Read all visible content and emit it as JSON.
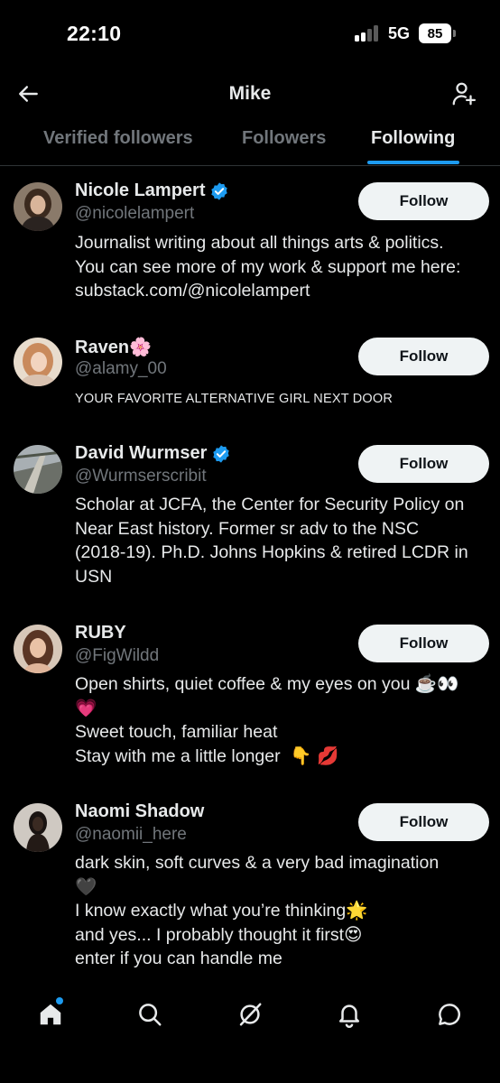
{
  "status_bar": {
    "time": "22:10",
    "network": "5G",
    "battery": "85"
  },
  "header": {
    "title": "Mike",
    "back_icon": "arrow-left-icon",
    "add_icon": "add-user-icon"
  },
  "tabs": [
    {
      "label": "Verified followers",
      "active": false
    },
    {
      "label": "Followers",
      "active": false
    },
    {
      "label": "Following",
      "active": true
    }
  ],
  "accent_color": "#1d9bf0",
  "users": [
    {
      "name": "Nicole Lampert",
      "verified": true,
      "handle": "@nicolelampert",
      "bio": "Journalist writing about all things arts & politics.\nYou can see more of my work & support me here:\nsubstack.com/@nicolelampert",
      "button": "Follow"
    },
    {
      "name": "Raven🌸",
      "verified": false,
      "handle": "@alamy_00",
      "bio": "YOUR FAVORITE ALTERNATIVE GIRL NEXT DOOR",
      "button": "Follow"
    },
    {
      "name": "David Wurmser",
      "verified": true,
      "handle": "@Wurmserscribit",
      "bio": "Scholar at JCFA, the Center for Security Policy on\nNear East history. Former sr adv to the NSC\n(2018-19). Ph.D. Johns Hopkins & retired LCDR in\nUSN",
      "button": "Follow"
    },
    {
      "name": "RUBY",
      "verified": false,
      "handle": "@FigWildd",
      "bio": "Open shirts, quiet coffee & my eyes on you ☕️👀\n💗\nSweet touch, familiar heat\nStay with me a little longer  👇 💋",
      "button": "Follow"
    },
    {
      "name": "Naomi Shadow",
      "verified": false,
      "handle": "@naomii_here",
      "bio": "dark skin, soft curves & a very bad imagination\n🖤\nI know exactly what you’re thinking🌟\nand yes... I probably thought it first😍\nenter if you can handle me",
      "button": "Follow"
    }
  ],
  "bottom_nav": [
    {
      "icon": "home-icon",
      "notification_dot": true
    },
    {
      "icon": "search-icon"
    },
    {
      "icon": "grok-icon"
    },
    {
      "icon": "bell-icon"
    },
    {
      "icon": "chat-icon"
    }
  ]
}
